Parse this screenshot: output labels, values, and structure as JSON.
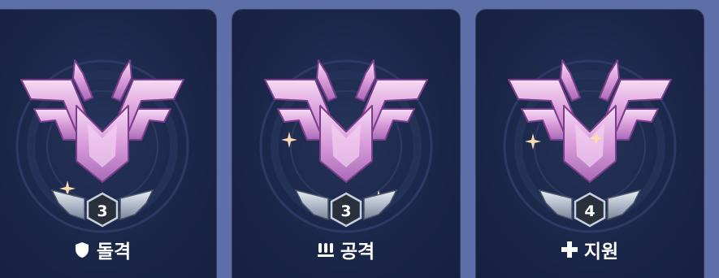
{
  "cards": [
    {
      "tier": "3",
      "role_label": "돌격",
      "role_icon": "shield-icon"
    },
    {
      "tier": "3",
      "role_label": "공격",
      "role_icon": "bullets-icon"
    },
    {
      "tier": "4",
      "role_label": "지원",
      "role_icon": "plus-cross-icon"
    }
  ],
  "colors": {
    "page_bg": "#5d6fa6",
    "card_bg": "#1b2749",
    "emblem_pink": "#e6a6e6",
    "text": "#ffffff"
  }
}
